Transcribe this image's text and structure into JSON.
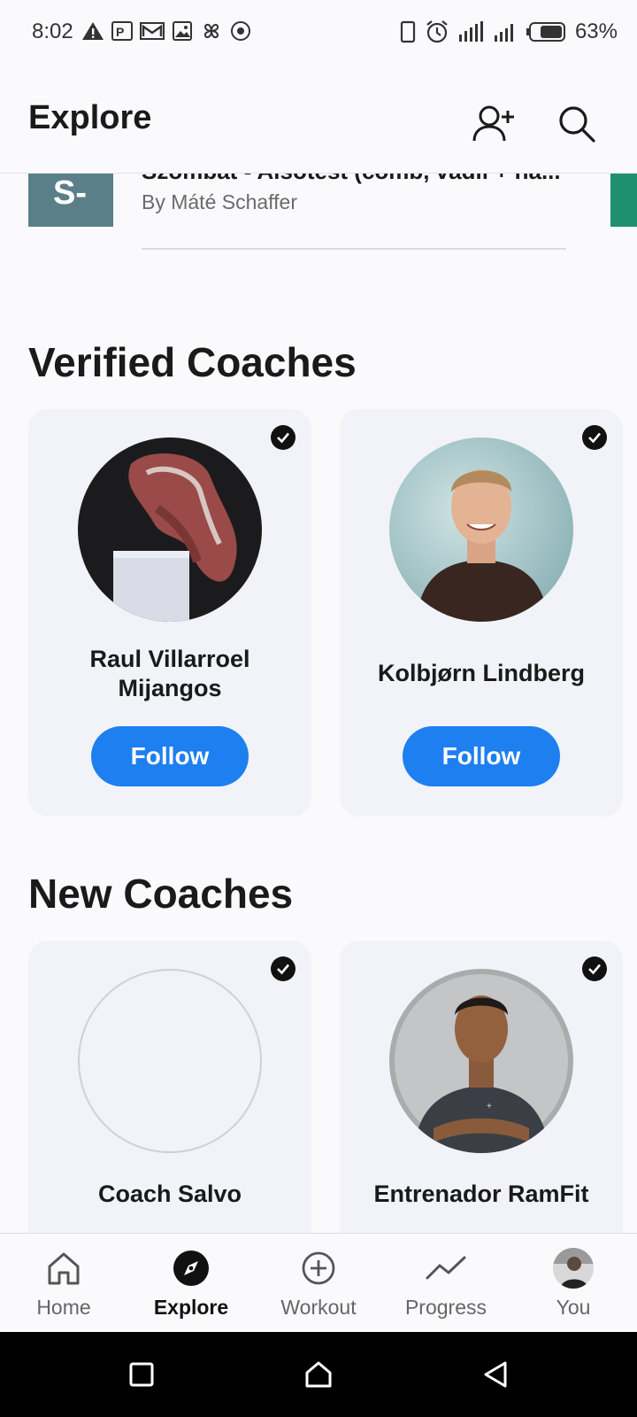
{
  "status_bar": {
    "time": "8:02",
    "battery_percent": "63%",
    "left_icons": [
      "warning-icon",
      "p-app-icon",
      "mail-icon",
      "image-icon",
      "pinwheel-icon",
      "target-icon"
    ],
    "right_icons": [
      "phone-icon",
      "alarm-icon",
      "signal-icon",
      "signal-icon",
      "battery-icon"
    ]
  },
  "header": {
    "title": "Explore",
    "icons": [
      "add-user-icon",
      "search-icon"
    ]
  },
  "plan_card": {
    "thumb_text": "S-",
    "title": "Szombat - Alsótest (comb, vádli + ha...",
    "author": "By Máté Schaffer"
  },
  "verified_coaches": {
    "title": "Verified Coaches",
    "coaches": [
      {
        "name_line1": "Raul Villarroel",
        "name_line2": "Mijangos",
        "follow_label": "Follow"
      },
      {
        "name_line1": "Kolbjørn Lindberg",
        "name_line2": "",
        "follow_label": "Follow"
      }
    ]
  },
  "new_coaches": {
    "title": "New Coaches",
    "coaches": [
      {
        "name": "Coach Salvo"
      },
      {
        "name": "Entrenador RamFit"
      }
    ]
  },
  "bottom_nav": {
    "items": [
      {
        "label": "Home",
        "icon": "home-icon",
        "active": false
      },
      {
        "label": "Explore",
        "icon": "compass-icon",
        "active": true
      },
      {
        "label": "Workout",
        "icon": "plus-circle-icon",
        "active": false
      },
      {
        "label": "Progress",
        "icon": "trend-icon",
        "active": false
      },
      {
        "label": "You",
        "icon": "avatar-icon",
        "active": false
      }
    ]
  },
  "colors": {
    "accent": "#1e7ff0",
    "card_bg": "#f1f3f9",
    "page_bg": "#fafafc",
    "plan_thumb": "#5b7f88",
    "plan_next": "#1f8f72"
  }
}
